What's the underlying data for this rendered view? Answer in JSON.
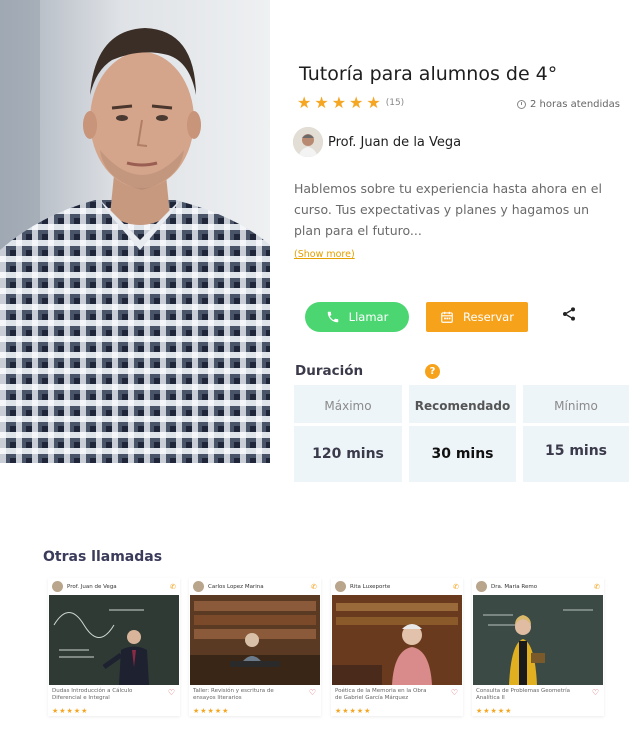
{
  "session": {
    "title": "Tutoría para alumnos de 4°",
    "rating_count": "(15)",
    "stars": 5,
    "hours": "2 horas atendidas",
    "teacher_name": "Prof. Juan de la Vega",
    "description": "Hablemos sobre tu experiencia hasta ahora en el curso. Tus expectativas y planes y hagamos un plan para el futuro...",
    "show_more": "(Show more)"
  },
  "actions": {
    "call_label": "Llamar",
    "book_label": "Reservar",
    "share_icon": "share-icon"
  },
  "duration": {
    "label": "Duración",
    "help": "?",
    "columns": [
      {
        "header": "Máximo",
        "value": "120 mins"
      },
      {
        "header": "Recomendado",
        "value": "30 mins"
      },
      {
        "header": "Mínimo",
        "value": "15 mins"
      }
    ]
  },
  "others": {
    "title": "Otras llamadas",
    "cards": [
      {
        "teacher": "Prof. Juan de Vega",
        "desc": "Dudas Introducción a Cálculo Diferencial e Integral"
      },
      {
        "teacher": "Carlos Lopez Marina",
        "desc": "Taller: Revisión y escritura de ensayos literarios"
      },
      {
        "teacher": "Rita Luxeporte",
        "desc": "Poética de la Memoria en la Obra de Gabriel García Márquez"
      },
      {
        "teacher": "Dra. María Remo",
        "desc": "Consulta de Problemas Geometría Analítica II"
      }
    ]
  },
  "colors": {
    "accent": "#f7a21b",
    "call_green": "#4cd672",
    "star": "#f5a623",
    "panel": "#eef5f9"
  }
}
